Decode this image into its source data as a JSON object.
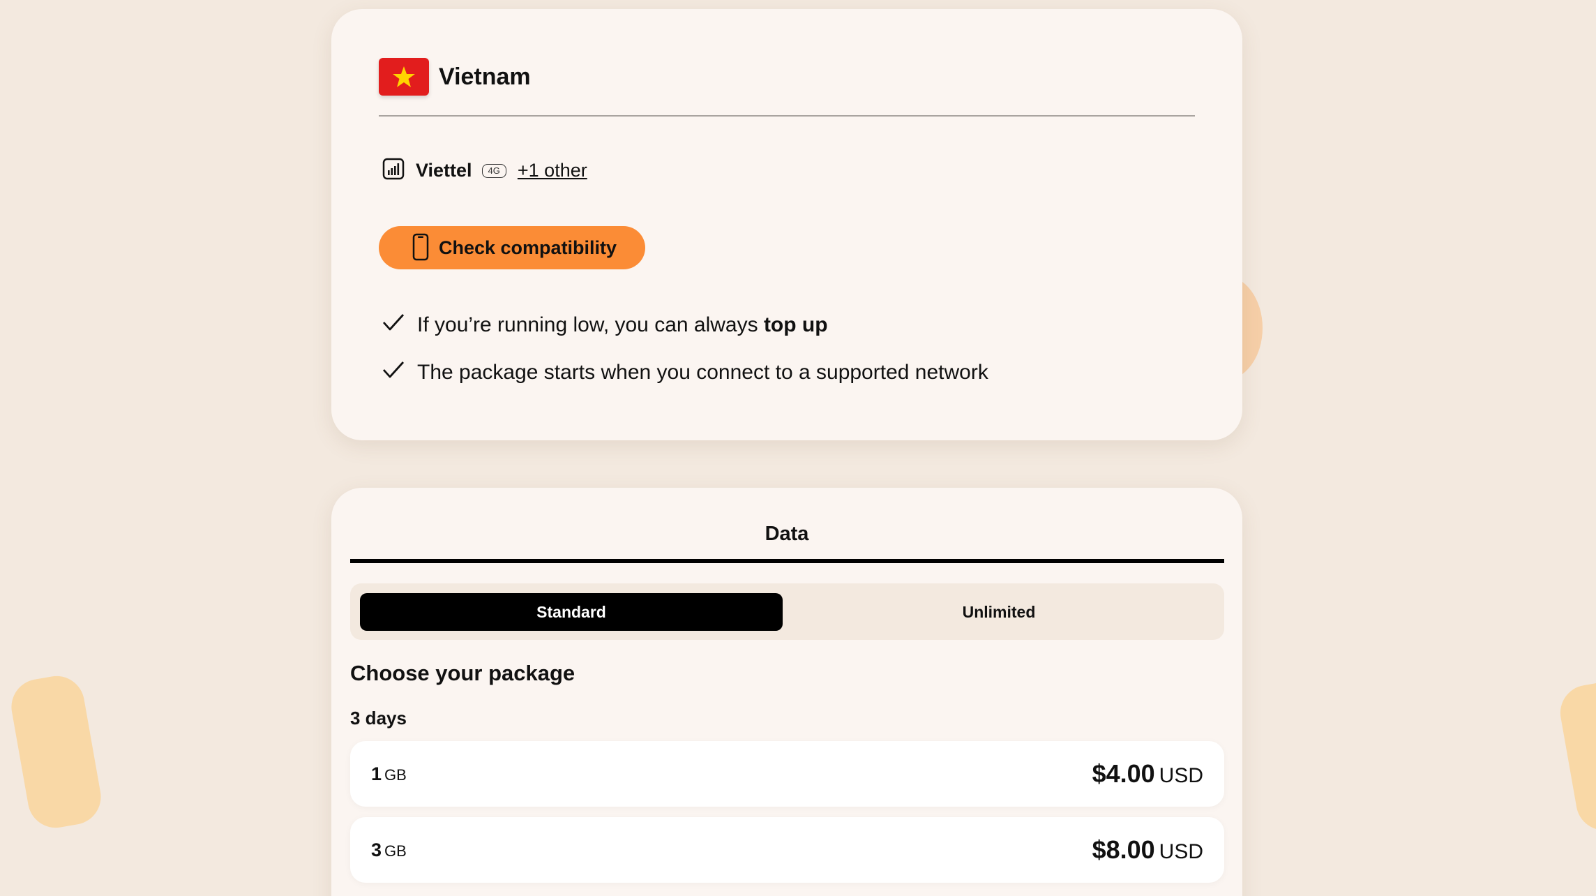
{
  "country": {
    "name": "Vietnam",
    "flag_color": "#e21d1d",
    "star_color": "#ffd400"
  },
  "network": {
    "icon": "signal-bars-icon",
    "name": "Viettel",
    "badge": "4G",
    "other_link": "+1 other"
  },
  "check_button": {
    "icon": "phone-icon",
    "label": "Check compatibility",
    "color": "#fb8c36"
  },
  "features": [
    {
      "icon": "checkmark-icon",
      "text": "If you’re running low, you can always ",
      "bold": "top up"
    },
    {
      "icon": "checkmark-icon",
      "text": "The package starts when you connect to a supported network",
      "bold": ""
    }
  ],
  "data_section": {
    "tab_label": "Data",
    "segments": {
      "standard": "Standard",
      "unlimited": "Unlimited",
      "selected": "Standard"
    },
    "choose_title": "Choose your package",
    "duration_label": "3 days",
    "packages": [
      {
        "amount": "1",
        "unit": "GB",
        "price": "$4.00",
        "currency": "USD"
      },
      {
        "amount": "3",
        "unit": "GB",
        "price": "$8.00",
        "currency": "USD"
      }
    ]
  }
}
